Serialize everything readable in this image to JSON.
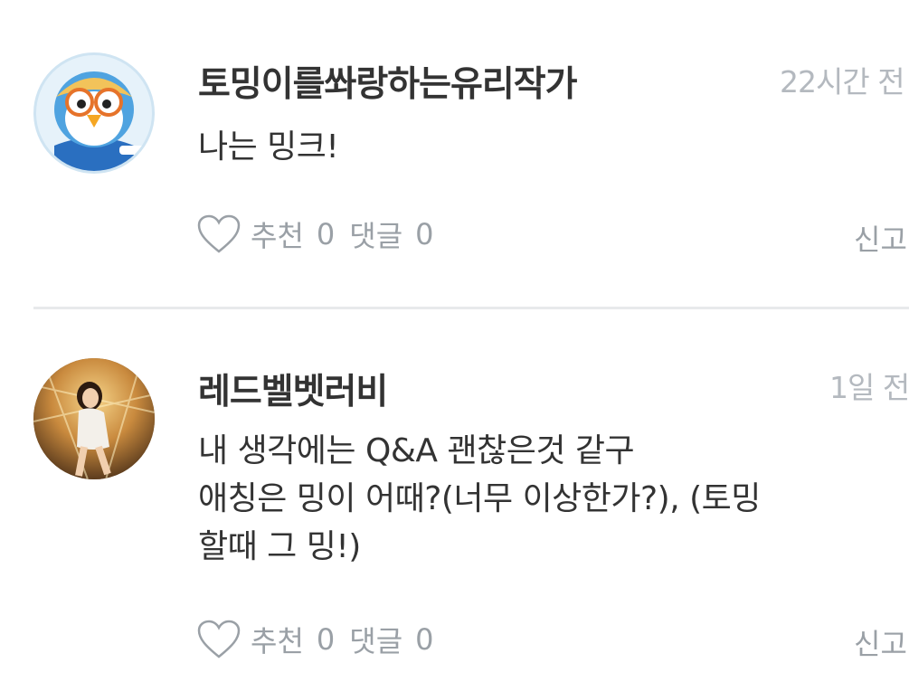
{
  "comments": [
    {
      "author": "토밍이를쏴랑하는유리작가",
      "time": "22시간 전",
      "body": "나는 밍크!",
      "like_label": "추천",
      "like_count": "0",
      "reply_label": "댓글",
      "reply_count": "0",
      "report_label": "신고",
      "avatar_icon": "penguin-avatar-icon"
    },
    {
      "author": "레드벨벳러비",
      "time": "1일 전",
      "body": "내 생각에는 Q&A 괜찮은것 같구\n애칭은 밍이 어때?(너무 이상한가?), (토밍\n할때 그 밍!)",
      "like_label": "추천",
      "like_count": "0",
      "reply_label": "댓글",
      "reply_count": "0",
      "report_label": "신고",
      "avatar_icon": "photo-avatar-icon"
    }
  ],
  "colors": {
    "text": "#333333",
    "muted": "#9aa0a6",
    "time": "#b4b9bf",
    "divider": "#e8e9eb"
  }
}
